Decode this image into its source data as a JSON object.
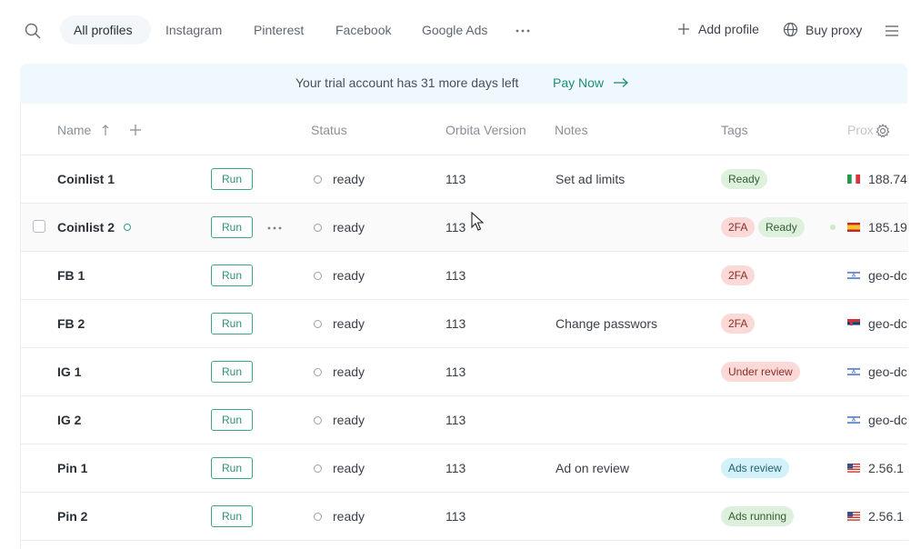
{
  "nav": {
    "tabs": [
      {
        "label": "All profiles",
        "active": true
      },
      {
        "label": "Instagram"
      },
      {
        "label": "Pinterest"
      },
      {
        "label": "Facebook"
      },
      {
        "label": "Google Ads"
      }
    ],
    "add_profile": "Add profile",
    "buy_proxy": "Buy proxy"
  },
  "banner": {
    "text": "Your trial account has 31 more days left",
    "action": "Pay Now"
  },
  "table": {
    "headers": {
      "name": "Name",
      "status": "Status",
      "version": "Orbita Version",
      "notes": "Notes",
      "tags": "Tags",
      "proxy": "Prox"
    },
    "run_label": "Run",
    "rows": [
      {
        "name": "Coinlist 1",
        "status": "ready",
        "version": "113",
        "note": "Set ad limits",
        "tags": [
          "Ready"
        ],
        "flag": "it",
        "proxy": "188.74"
      },
      {
        "name": "Coinlist 2",
        "status": "ready",
        "version": "113",
        "note": "",
        "tags": [
          "2FA",
          "Ready"
        ],
        "flag": "es",
        "proxy": "185.19"
      },
      {
        "name": "FB 1",
        "status": "ready",
        "version": "113",
        "note": "",
        "tags": [
          "2FA"
        ],
        "flag": "il",
        "proxy": "geo-dc"
      },
      {
        "name": "FB 2",
        "status": "ready",
        "version": "113",
        "note": "Change passwors",
        "tags": [
          "2FA"
        ],
        "flag": "rs",
        "proxy": "geo-dc"
      },
      {
        "name": "IG 1",
        "status": "ready",
        "version": "113",
        "note": "",
        "tags": [
          "Under review"
        ],
        "flag": "il",
        "proxy": "geo-dc"
      },
      {
        "name": "IG 2",
        "status": "ready",
        "version": "113",
        "note": "",
        "tags": [],
        "flag": "il",
        "proxy": "geo-dc"
      },
      {
        "name": "Pin 1",
        "status": "ready",
        "version": "113",
        "note": "Ad on review",
        "tags": [
          "Ads review"
        ],
        "flag": "us",
        "proxy": "2.56.1"
      },
      {
        "name": "Pin 2",
        "status": "ready",
        "version": "113",
        "note": "",
        "tags": [
          "Ads running"
        ],
        "flag": "us",
        "proxy": "2.56.1"
      }
    ]
  },
  "colors": {
    "accent": "#1f8e78",
    "banner_bg": "#eef8fd",
    "tag_ready": "#ddf1dc",
    "tag_2fa": "#fbd9d7",
    "tag_ads_review": "#d3f1f8"
  },
  "icons": [
    "search-icon",
    "more-horizontal-icon",
    "plus-icon",
    "globe-icon",
    "menu-icon",
    "arrow-right-icon",
    "sort-arrow-icon",
    "gear-icon"
  ]
}
